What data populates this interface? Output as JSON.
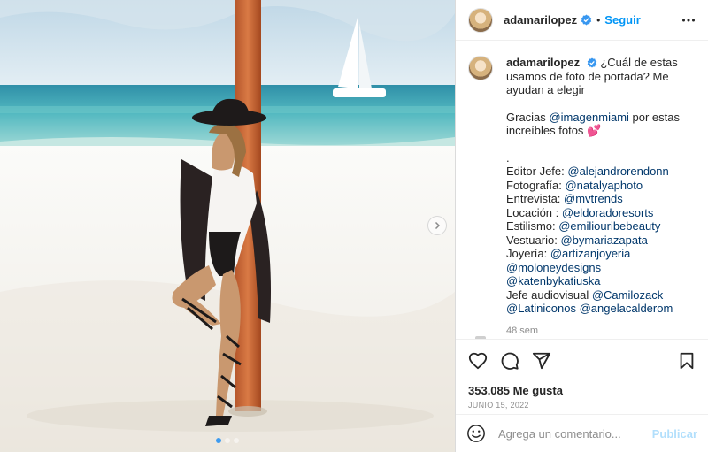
{
  "post": {
    "username": "adamarilopez",
    "separator": "•",
    "follow_label": "Seguir",
    "caption_intro": "¿Cuál de estas usamos de foto de portada? Me ayudan a elegir",
    "thanks_pre": "Gracias ",
    "thanks_handle": "@imagenmiami",
    "thanks_post": " por estas increíbles fotos 💕",
    "dot": ".",
    "credits": [
      {
        "label": "Editor Jefe: ",
        "handles": [
          "@alejandrorendonn"
        ]
      },
      {
        "label": "Fotografía: ",
        "handles": [
          "@natalyaphoto"
        ]
      },
      {
        "label": "Entrevista: ",
        "handles": [
          "@mvtrends"
        ]
      },
      {
        "label": "Locación : ",
        "handles": [
          "@eldoradoresorts"
        ]
      },
      {
        "label": "Estilismo: ",
        "handles": [
          "@emiliouribebeauty"
        ]
      },
      {
        "label": "Vestuario: ",
        "handles": [
          "@bymariazapata"
        ]
      },
      {
        "label": "Joyería: ",
        "handles": [
          "@artizanjoyeria",
          "@moloneydesigns",
          "@katenbykatiuska"
        ]
      },
      {
        "label": "Jefe audiovisual ",
        "handles": [
          "@Camilozack",
          "@Latiniconos",
          "@angelacalderom"
        ]
      }
    ],
    "time_ago": "48 sem",
    "likes": "353.085 Me gusta",
    "date": "JUNIO 15, 2022",
    "comment_placeholder": "Agrega un comentario...",
    "post_label": "Publicar",
    "carousel": {
      "slide_count": 3,
      "active_index": 0
    }
  },
  "icons": {
    "verified": "verified-badge-icon",
    "more": "more-options-icon",
    "like": "heart-icon",
    "comment": "comment-icon",
    "share": "share-icon",
    "save": "bookmark-icon",
    "emoji": "emoji-icon",
    "next": "chevron-right-icon"
  },
  "colors": {
    "link": "#00376b",
    "follow": "#0095f6",
    "verified": "#3897f0",
    "post_disabled": "#b2dffc",
    "heart": "#ff3fa4"
  }
}
